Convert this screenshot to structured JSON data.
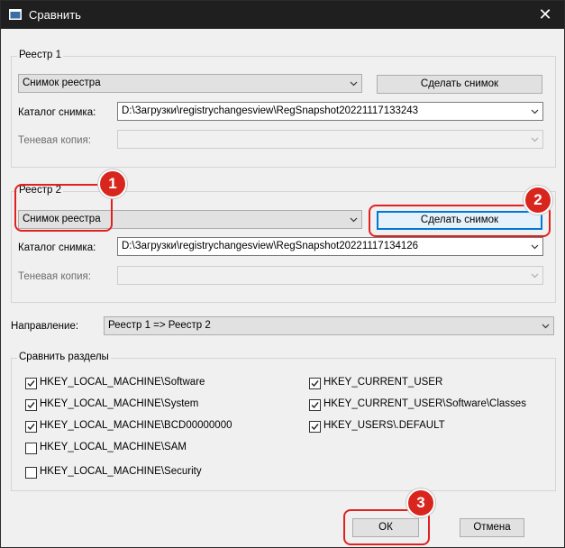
{
  "window": {
    "title": "Сравнить",
    "close_glyph": "✕"
  },
  "registry1": {
    "group_label": "Реестр 1",
    "source_value": "Снимок реестра",
    "snapshot_button": "Сделать снимок",
    "catalog_label": "Каталог снимка:",
    "catalog_value": "D:\\Загрузки\\registrychangesview\\RegSnapshot20221117133243",
    "shadow_label": "Теневая копия:",
    "shadow_value": ""
  },
  "registry2": {
    "group_label": "Реестр 2",
    "source_value": "Снимок реестра",
    "snapshot_button": "Сделать снимок",
    "catalog_label": "Каталог снимка:",
    "catalog_value": "D:\\Загрузки\\registrychangesview\\RegSnapshot20221117134126",
    "shadow_label": "Теневая копия:",
    "shadow_value": ""
  },
  "direction": {
    "label": "Направление:",
    "value": "Реестр 1 => Реестр 2"
  },
  "compare": {
    "group_label": "Сравнить разделы",
    "left": [
      {
        "label": "HKEY_LOCAL_MACHINE\\Software",
        "checked": true
      },
      {
        "label": "HKEY_LOCAL_MACHINE\\System",
        "checked": true
      },
      {
        "label": "HKEY_LOCAL_MACHINE\\BCD00000000",
        "checked": true
      },
      {
        "label": "HKEY_LOCAL_MACHINE\\SAM",
        "checked": false
      },
      {
        "label": "HKEY_LOCAL_MACHINE\\Security",
        "checked": false
      }
    ],
    "right": [
      {
        "label": "HKEY_CURRENT_USER",
        "checked": true
      },
      {
        "label": "HKEY_CURRENT_USER\\Software\\Classes",
        "checked": true
      },
      {
        "label": "HKEY_USERS\\.DEFAULT",
        "checked": true
      }
    ]
  },
  "buttons": {
    "ok": "ОК",
    "cancel": "Отмена"
  },
  "annotations": {
    "badge1": "1",
    "badge2": "2",
    "badge3": "3",
    "color": "#e0211f"
  }
}
